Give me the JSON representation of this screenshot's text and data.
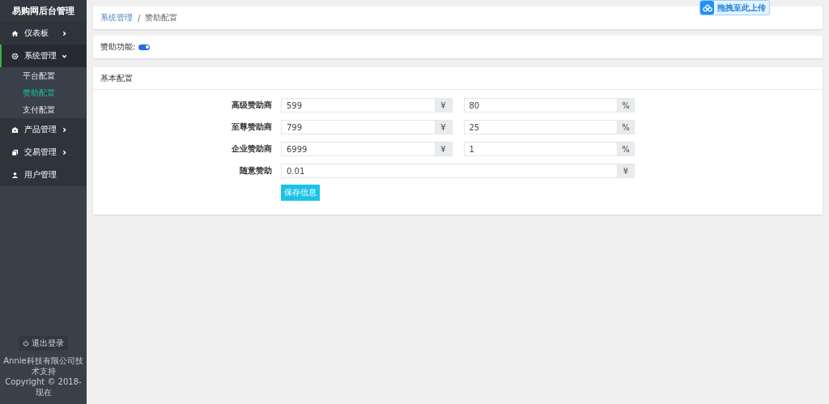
{
  "sidebar": {
    "title": "易购网后台管理",
    "items": [
      {
        "label": "仪表板",
        "expanded": false,
        "selected": false,
        "has_arrow": true
      },
      {
        "label": "系统管理",
        "expanded": true,
        "selected": true,
        "has_arrow": true,
        "children": [
          {
            "label": "平台配置",
            "selected": false
          },
          {
            "label": "赞助配置",
            "selected": true
          },
          {
            "label": "支付配置",
            "selected": false
          }
        ]
      },
      {
        "label": "产品管理",
        "expanded": false,
        "selected": false,
        "has_arrow": true
      },
      {
        "label": "交易管理",
        "expanded": false,
        "selected": false,
        "has_arrow": true
      },
      {
        "label": "用户管理",
        "selected": false,
        "has_arrow": false
      }
    ],
    "logout": "退出登录",
    "footer": [
      "Annie科技有限公司技术支持",
      "Copyright © 2018-现在"
    ]
  },
  "breadcrumb_separator": "/",
  "breadcrumb": [
    {
      "label": "系统管理",
      "kind": "link"
    },
    {
      "label": "赞助配置",
      "kind": "current"
    }
  ],
  "upload_badge": "拖拽至此上传",
  "feature": {
    "label": "赞助功能:",
    "on": true
  },
  "panel": {
    "title": "基本配置",
    "rows": [
      {
        "label": "高级赞助商",
        "fields": [
          {
            "value": "599",
            "addon": "¥"
          },
          {
            "value": "80",
            "addon": "%"
          }
        ]
      },
      {
        "label": "至尊赞助商",
        "fields": [
          {
            "value": "799",
            "addon": "¥"
          },
          {
            "value": "25",
            "addon": "%"
          }
        ]
      },
      {
        "label": "企业赞助商",
        "fields": [
          {
            "value": "6999",
            "addon": "¥"
          },
          {
            "value": "1",
            "addon": "%"
          }
        ]
      },
      {
        "label": "随意赞助",
        "fields": [
          {
            "value": "0.01",
            "addon": "¥"
          }
        ]
      }
    ],
    "save": "保存信息"
  }
}
